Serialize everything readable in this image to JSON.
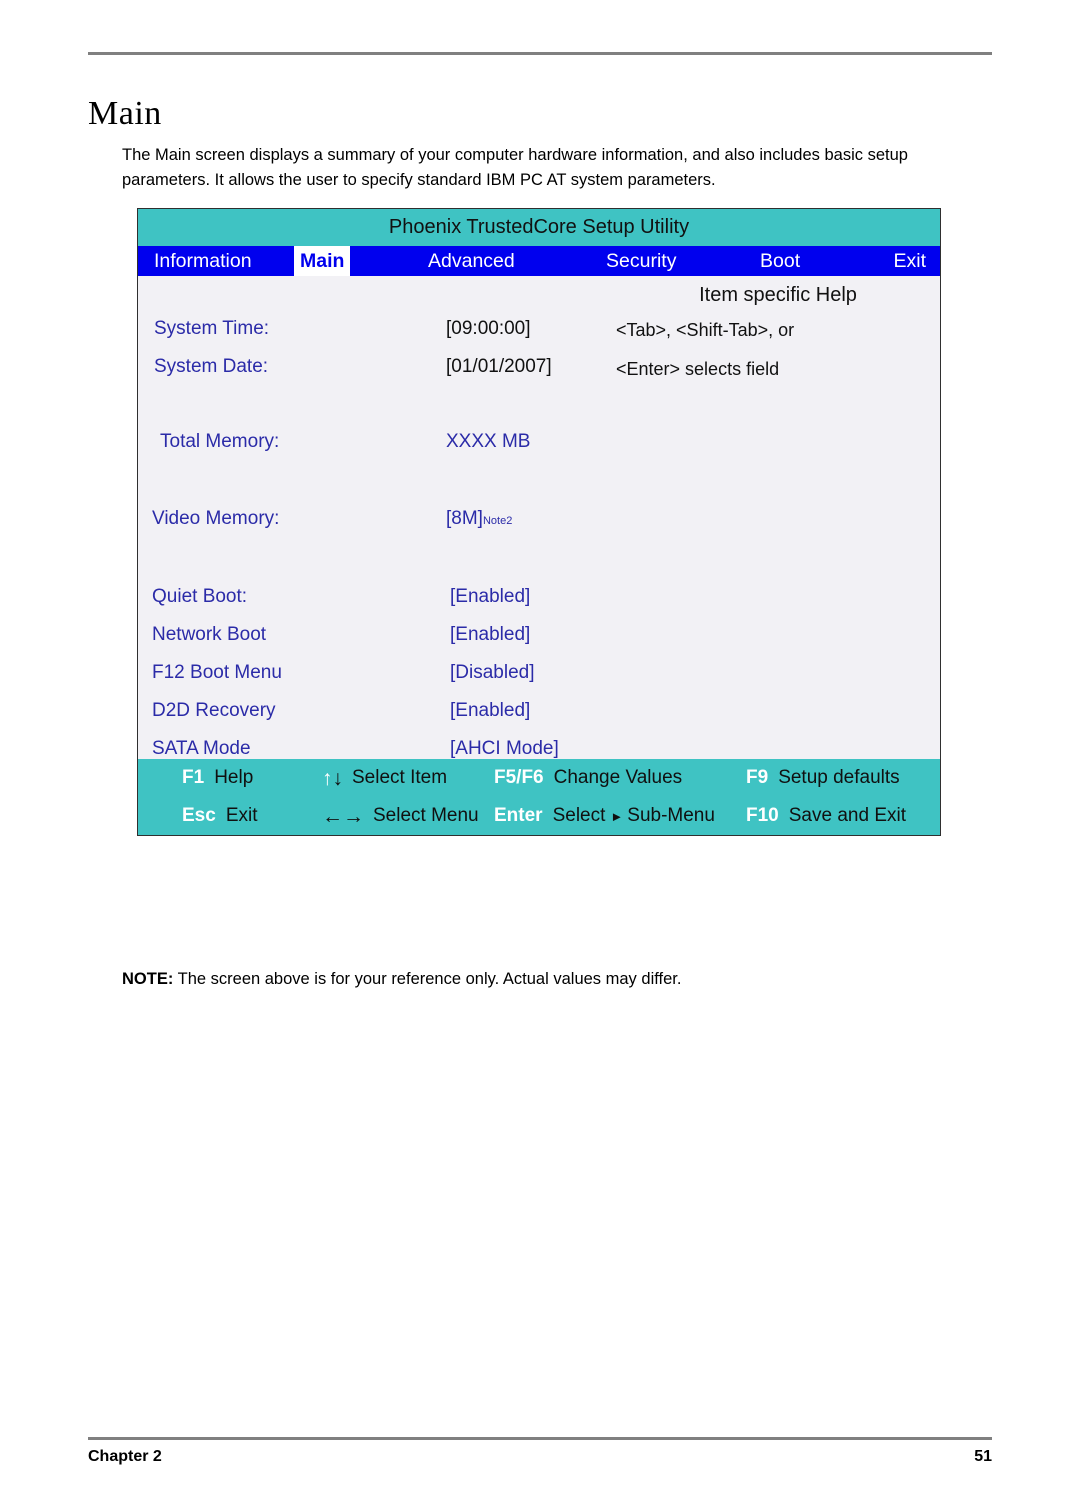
{
  "document": {
    "heading": "Main",
    "intro": "The Main screen displays a summary of your computer hardware information, and also includes basic setup parameters. It allows the user to specify standard IBM PC AT system parameters.",
    "note_prefix": "NOTE:",
    "note_text": " The screen above is for your reference only. Actual values may differ.",
    "footer_left": "Chapter 2",
    "footer_right": "51"
  },
  "bios": {
    "title": "Phoenix TrustedCore Setup Utility",
    "colors": {
      "title_bar": "#3fc3c3",
      "menu_bar": "#0000ee",
      "body": "#f2f1f5",
      "label_text": "#2b2ba8",
      "key_bar": "#3fc3c3"
    },
    "menu": [
      {
        "label": "Information",
        "selected": false
      },
      {
        "label": "Main",
        "selected": true
      },
      {
        "label": "Advanced",
        "selected": false
      },
      {
        "label": "Security",
        "selected": false
      },
      {
        "label": "Boot",
        "selected": false
      },
      {
        "label": "Exit",
        "selected": false
      }
    ],
    "help": {
      "title": "Item specific Help",
      "line1": "<Tab>, <Shift-Tab>, or",
      "line2": "<Enter> selects field"
    },
    "fields": [
      {
        "label": "System Time:",
        "value": "[09:00:00]"
      },
      {
        "label": "System Date:",
        "value": "[01/01/2007]"
      },
      {
        "label": "Total Memory:",
        "value": "XXXX MB"
      },
      {
        "label": "Video Memory:",
        "value": "[8M]",
        "value_note": "Note2"
      },
      {
        "label": "Quiet Boot:",
        "value": "[Enabled]"
      },
      {
        "label": "Network Boot",
        "value": "[Enabled]"
      },
      {
        "label": "F12 Boot Menu",
        "value": "[Disabled]"
      },
      {
        "label": "D2D Recovery",
        "value": "[Enabled]"
      },
      {
        "label": "SATA Mode",
        "value": "[AHCI Mode]"
      }
    ],
    "keybar": [
      {
        "key": "F1",
        "desc": "Help"
      },
      {
        "key": "",
        "glyph": "updown",
        "desc": "Select Item"
      },
      {
        "key": "F5/F6",
        "desc": "Change Values"
      },
      {
        "key": "F9",
        "desc": "Setup defaults"
      },
      {
        "key": "Esc",
        "desc": "Exit"
      },
      {
        "key": "",
        "glyph": "leftright",
        "desc": "Select Menu"
      },
      {
        "key": "Enter",
        "desc": "Select",
        "desc2": "Sub-Menu"
      },
      {
        "key": "F10",
        "desc": "Save and Exit"
      }
    ]
  }
}
